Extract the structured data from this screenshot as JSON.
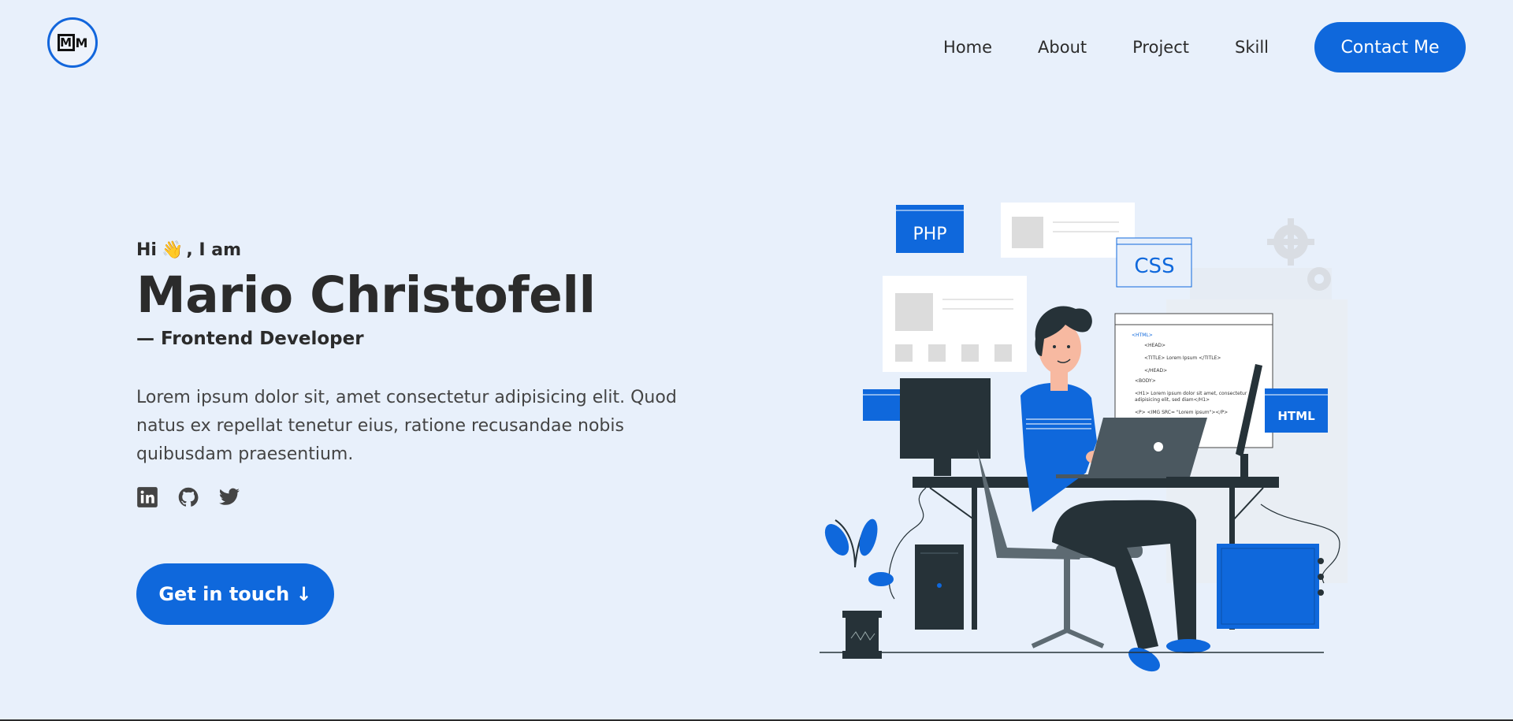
{
  "logo": {
    "text_boxed": "M",
    "text_plain": "M"
  },
  "nav": {
    "links": [
      "Home",
      "About",
      "Project",
      "Skill"
    ],
    "contact_label": "Contact Me"
  },
  "hero": {
    "greeting_hi": "Hi",
    "wave_emoji": "👋",
    "greeting_rest": ", I am",
    "name": "Mario Christofell",
    "role": "— Frontend Developer",
    "description": "Lorem ipsum dolor sit, amet consectetur adipisicing elit. Quod natus ex repellat tenetur eius, ratione recusandae nobis quibusdam praesentium.",
    "cta_label": "Get in touch ↓"
  },
  "socials": [
    "linkedin-icon",
    "github-icon",
    "twitter-icon"
  ],
  "illustration": {
    "php_label": "PHP",
    "css_label": "CSS",
    "html_label": "HTML",
    "code_lines": [
      "<HTML>",
      "<HEAD>",
      "<TITLE> Lorem Ipsum </TITLE>",
      "</HEAD>",
      "<BODY>",
      "<H1> Lorem ipsum dolor sit amet, consectetur",
      "adipisicing elit, sed diam</H1>",
      "<P> <IMG SRC= \"Lorem ipsum\"></P>"
    ]
  },
  "colors": {
    "accent": "#0f68dc",
    "background": "#e8f0fb",
    "text": "#2b2b2b"
  }
}
